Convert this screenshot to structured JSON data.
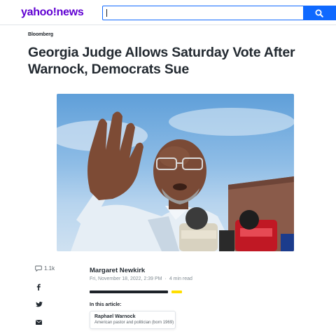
{
  "header": {
    "logo_yahoo": "yahoo",
    "logo_bang": "!",
    "logo_news": "news",
    "search": {
      "value": "",
      "placeholder": ""
    },
    "search_icon": "search-icon",
    "colors": {
      "brand": "#6001d2",
      "search_button": "#0f69ff"
    }
  },
  "article": {
    "provider": "Bloomberg",
    "headline": "Georgia Judge Allows Saturday Vote After Warnock, Democrats Sue",
    "hero_image": "man-speaking-at-microphones-photo"
  },
  "share_rail": {
    "comments_icon": "comment-icon",
    "comments_count": "1.1k",
    "facebook_icon": "facebook-icon",
    "twitter_icon": "twitter-icon",
    "email_icon": "mail-icon"
  },
  "byline": {
    "author": "Margaret Newkirk",
    "date": "Fri, November 18, 2022, 2:39 PM",
    "separator": "·",
    "read_time": "4 min read",
    "progress_colors": {
      "track": "#1d2228",
      "accent": "#ffde00"
    }
  },
  "in_this_article": {
    "label": "In this article:",
    "entities": [
      {
        "name": "Raphael Warnock",
        "description": "American pastor and politician (born 1969)"
      }
    ]
  }
}
